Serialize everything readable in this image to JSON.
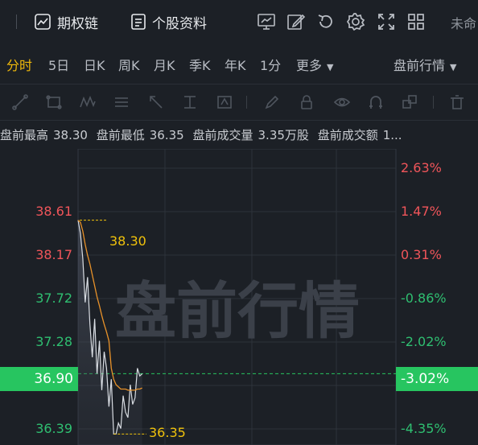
{
  "toolbar": {
    "options_chain_label": "期权链",
    "stock_info_label": "个股资料",
    "unfavorite_label": "未命"
  },
  "tabs": [
    {
      "label": "分时",
      "active": true
    },
    {
      "label": "5日"
    },
    {
      "label": "日K"
    },
    {
      "label": "周K"
    },
    {
      "label": "月K"
    },
    {
      "label": "季K"
    },
    {
      "label": "年K"
    },
    {
      "label": "1分"
    },
    {
      "label": "更多"
    },
    {
      "label": "盘前行情"
    }
  ],
  "premarket_info": {
    "high_label": "盘前最高",
    "high_value": "38.30",
    "low_label": "盘前最低",
    "low_value": "36.35",
    "volume_label": "盘前成交量",
    "volume_value": "3.35万股",
    "turnover_label": "盘前成交额",
    "turnover_value": "1..."
  },
  "chart": {
    "watermark": "盘前行情",
    "current_price": "36.90",
    "current_pct": "-3.02%",
    "high_annotation": "38.30",
    "low_annotation": "36.35"
  },
  "chart_data": {
    "type": "line",
    "title": "",
    "left_axis_ticks": [
      "38.61",
      "38.17",
      "37.72",
      "37.28",
      "36.90",
      "36.39"
    ],
    "right_axis_ticks": [
      "2.63%",
      "1.47%",
      "0.31%",
      "-0.86%",
      "-2.02%",
      "-3.02%",
      "-4.35%"
    ],
    "ylim": [
      36.25,
      38.95
    ],
    "series": [
      {
        "role": "price",
        "color": "#d9dde3",
        "values": [
          38.3,
          38.18,
          37.95,
          37.55,
          37.78,
          37.35,
          37.05,
          37.4,
          36.9,
          37.2,
          36.75,
          37.1,
          36.95,
          36.6,
          36.85,
          36.35,
          36.35,
          36.45,
          36.4,
          36.7,
          36.55,
          36.5,
          36.8,
          36.62,
          36.68,
          36.95,
          36.88,
          36.9
        ]
      },
      {
        "role": "average",
        "color": "#e8922a",
        "values": [
          38.3,
          38.28,
          38.2,
          38.08,
          37.98,
          37.9,
          37.8,
          37.7,
          37.6,
          37.52,
          37.43,
          37.35,
          37.28,
          37.2,
          36.95,
          36.85,
          36.8,
          36.78,
          36.76,
          36.76,
          36.76,
          36.75,
          36.75,
          36.75,
          36.75,
          36.76,
          36.76,
          36.77
        ]
      }
    ],
    "reference_price": 36.9,
    "grid": true
  },
  "colors": {
    "accent": "#f0b90b",
    "up": "#f0555a",
    "down": "#2fbf71",
    "current_box": "#27c560",
    "background": "#1c2026"
  }
}
